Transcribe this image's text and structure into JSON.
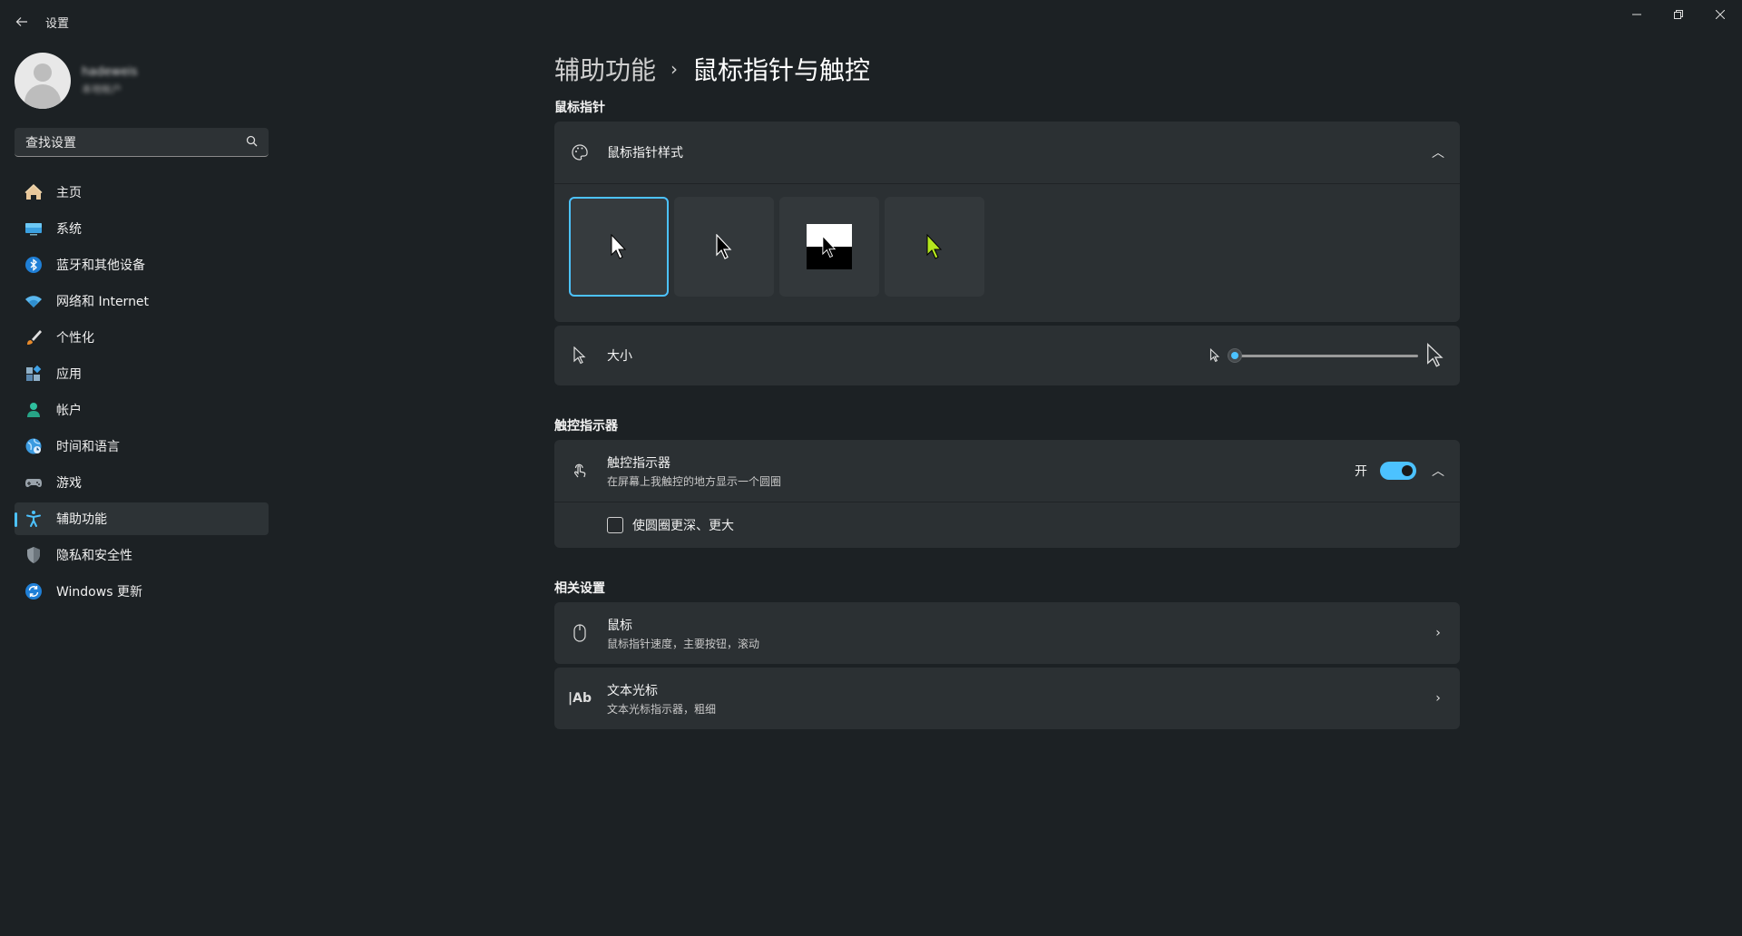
{
  "window": {
    "title": "设置"
  },
  "profile": {
    "name": "hadeweis",
    "account_type": "本地帐户"
  },
  "search": {
    "placeholder": "查找设置"
  },
  "sidebar": {
    "items": [
      {
        "label": "主页",
        "icon": "home-icon"
      },
      {
        "label": "系统",
        "icon": "system-icon"
      },
      {
        "label": "蓝牙和其他设备",
        "icon": "bluetooth-icon"
      },
      {
        "label": "网络和 Internet",
        "icon": "network-icon"
      },
      {
        "label": "个性化",
        "icon": "brush-icon"
      },
      {
        "label": "应用",
        "icon": "apps-icon"
      },
      {
        "label": "帐户",
        "icon": "account-icon"
      },
      {
        "label": "时间和语言",
        "icon": "time-language-icon"
      },
      {
        "label": "游戏",
        "icon": "gamepad-icon"
      },
      {
        "label": "辅助功能",
        "icon": "accessibility-icon",
        "active": true
      },
      {
        "label": "隐私和安全性",
        "icon": "shield-icon"
      },
      {
        "label": "Windows 更新",
        "icon": "update-icon"
      }
    ]
  },
  "breadcrumb": {
    "parent": "辅助功能",
    "current": "鼠标指针与触控"
  },
  "mouse_pointer": {
    "section_title": "鼠标指针",
    "style_title": "鼠标指针样式",
    "styles": [
      "white",
      "black",
      "inverted",
      "custom"
    ],
    "selected_style": 0,
    "custom_color": "#b4e61e",
    "size_label": "大小",
    "size_value_fraction": 0.0
  },
  "touch": {
    "section_title": "触控指示器",
    "title": "触控指示器",
    "subtitle": "在屏幕上我触控的地方显示一个圆圈",
    "toggle_state_label": "开",
    "toggle_on": true,
    "checkbox_label": "使圆圈更深、更大",
    "checkbox_checked": false
  },
  "related": {
    "section_title": "相关设置",
    "items": [
      {
        "title": "鼠标",
        "subtitle": "鼠标指针速度，主要按钮，滚动"
      },
      {
        "title": "文本光标",
        "subtitle": "文本光标指示器，粗细"
      }
    ]
  },
  "colors": {
    "accent": "#4cc2ff",
    "background": "#1c2124",
    "card": "#2b3033"
  }
}
